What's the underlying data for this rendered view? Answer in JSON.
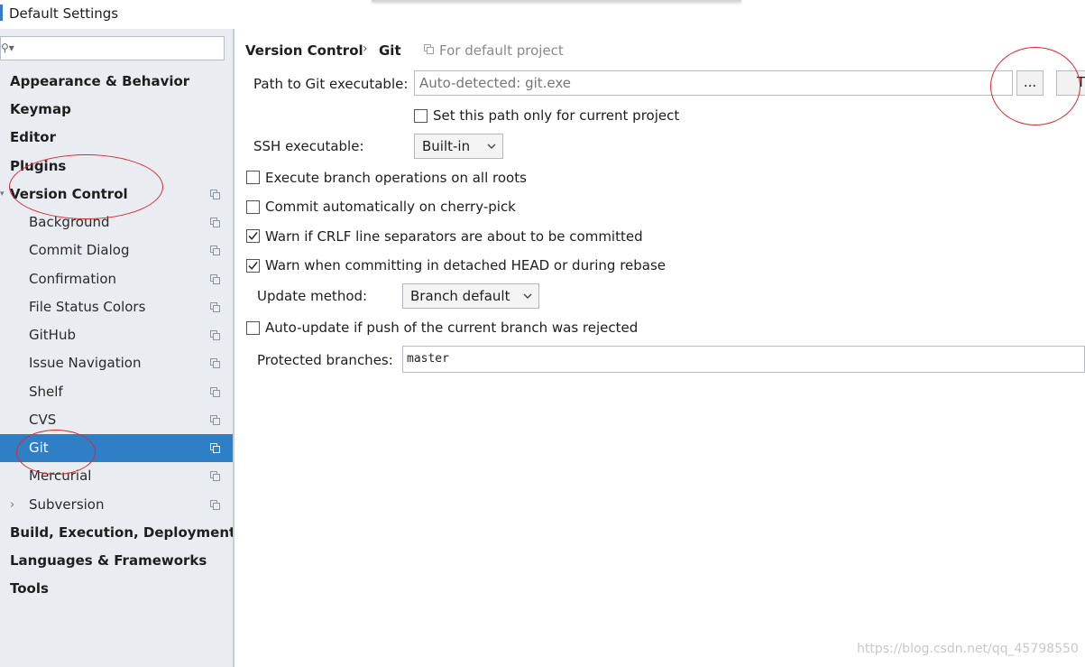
{
  "window": {
    "title": "Default Settings"
  },
  "sidebar": {
    "search_value": "",
    "items": [
      {
        "label": "Appearance & Behavior",
        "level": "top"
      },
      {
        "label": "Keymap",
        "level": "top"
      },
      {
        "label": "Editor",
        "level": "top"
      },
      {
        "label": "Plugins",
        "level": "top"
      },
      {
        "label": "Version Control",
        "level": "top"
      },
      {
        "label": "Background",
        "level": "sub"
      },
      {
        "label": "Commit Dialog",
        "level": "sub"
      },
      {
        "label": "Confirmation",
        "level": "sub"
      },
      {
        "label": "File Status Colors",
        "level": "sub"
      },
      {
        "label": "GitHub",
        "level": "sub"
      },
      {
        "label": "Issue Navigation",
        "level": "sub"
      },
      {
        "label": "Shelf",
        "level": "sub"
      },
      {
        "label": "CVS",
        "level": "sub"
      },
      {
        "label": "Git",
        "level": "sub",
        "selected": true
      },
      {
        "label": "Mercurial",
        "level": "sub"
      },
      {
        "label": "Subversion",
        "level": "sub"
      },
      {
        "label": "Build, Execution, Deployment",
        "level": "top"
      },
      {
        "label": "Languages & Frameworks",
        "level": "top"
      },
      {
        "label": "Tools",
        "level": "top"
      }
    ]
  },
  "header": {
    "crumb_parent": "Version Control",
    "crumb_sep": "›",
    "crumb_current": "Git",
    "scope": "For default project"
  },
  "git": {
    "path_label": "Path to Git executable:",
    "path_placeholder": "Auto-detected: git.exe",
    "browse_label": "...",
    "test_label": "T",
    "current_project_label": "Set this path only for current project",
    "ssh_label": "SSH executable:",
    "ssh_value": "Built-in",
    "options": [
      {
        "label": "Execute branch operations on all roots",
        "checked": false
      },
      {
        "label": "Commit automatically on cherry-pick",
        "checked": false
      },
      {
        "label": "Warn if CRLF line separators are about to be committed",
        "checked": true
      },
      {
        "label": "Warn when committing in detached HEAD or during rebase",
        "checked": true
      }
    ],
    "update_label": "Update method:",
    "update_value": "Branch default",
    "autoupdate_label": "Auto-update if push of the current branch was rejected",
    "protected_label": "Protected branches:",
    "protected_value": "master"
  },
  "watermark": "https://blog.csdn.net/qq_45798550",
  "colors": {
    "selection": "#2f7fc6",
    "sidebar_bg": "#e9edf2",
    "annotation": "#e0262c"
  }
}
